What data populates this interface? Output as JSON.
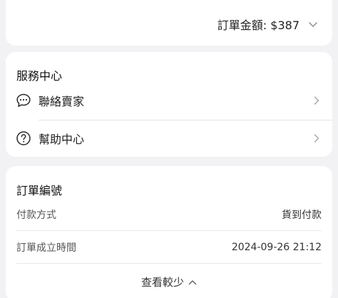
{
  "order_total": {
    "label": "訂單金額: $387"
  },
  "service_center": {
    "title": "服務中心",
    "items": [
      {
        "label": "聯絡賣家",
        "icon": "chat-bubble-icon"
      },
      {
        "label": "幫助中心",
        "icon": "question-circle-icon"
      }
    ]
  },
  "order_info": {
    "title": "訂單編號",
    "rows": [
      {
        "label": "付款方式",
        "value": "貨到付款"
      },
      {
        "label": "訂單成立時間",
        "value": "2024-09-26 21:12"
      }
    ],
    "toggle_label": "查看較少"
  }
}
